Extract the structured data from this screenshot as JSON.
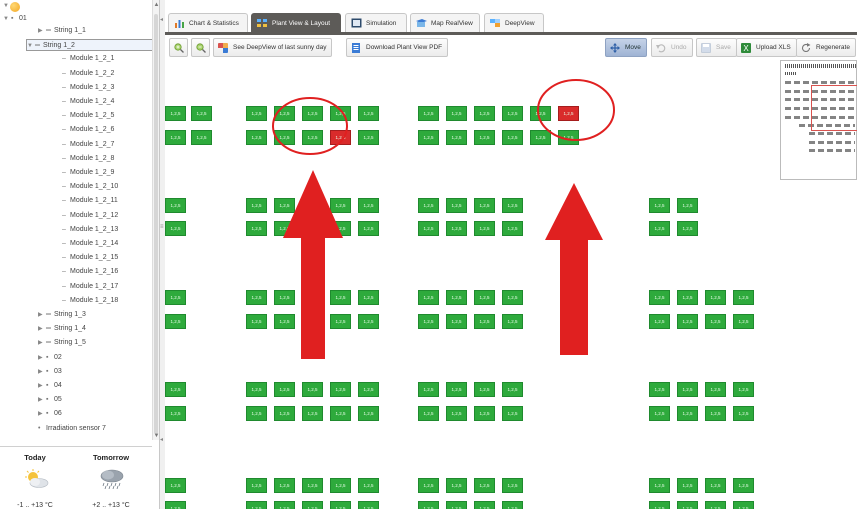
{
  "tree": {
    "root": {
      "label": "01"
    },
    "items": [
      {
        "label": "String 1_1",
        "type": "string",
        "expanded": false
      },
      {
        "label": "String 1_2",
        "type": "string",
        "expanded": true,
        "selected": true
      },
      {
        "label": "Module 1_2_1",
        "type": "module"
      },
      {
        "label": "Module 1_2_2",
        "type": "module"
      },
      {
        "label": "Module 1_2_3",
        "type": "module"
      },
      {
        "label": "Module 1_2_4",
        "type": "module"
      },
      {
        "label": "Module 1_2_5",
        "type": "module"
      },
      {
        "label": "Module 1_2_6",
        "type": "module"
      },
      {
        "label": "Module 1_2_7",
        "type": "module"
      },
      {
        "label": "Module 1_2_8",
        "type": "module"
      },
      {
        "label": "Module 1_2_9",
        "type": "module"
      },
      {
        "label": "Module 1_2_10",
        "type": "module"
      },
      {
        "label": "Module 1_2_11",
        "type": "module"
      },
      {
        "label": "Module 1_2_12",
        "type": "module"
      },
      {
        "label": "Module 1_2_13",
        "type": "module"
      },
      {
        "label": "Module 1_2_14",
        "type": "module"
      },
      {
        "label": "Module 1_2_15",
        "type": "module"
      },
      {
        "label": "Module 1_2_16",
        "type": "module"
      },
      {
        "label": "Module 1_2_17",
        "type": "module"
      },
      {
        "label": "Module 1_2_18",
        "type": "module"
      },
      {
        "label": "String 1_3",
        "type": "string",
        "expanded": false
      },
      {
        "label": "String 1_4",
        "type": "string",
        "expanded": false
      },
      {
        "label": "String 1_5",
        "type": "string",
        "expanded": false
      },
      {
        "label": "02",
        "type": "group"
      },
      {
        "label": "03",
        "type": "group"
      },
      {
        "label": "04",
        "type": "group"
      },
      {
        "label": "05",
        "type": "group"
      },
      {
        "label": "06",
        "type": "group"
      },
      {
        "label": "Irradiation sensor 7",
        "type": "sensor"
      }
    ]
  },
  "weather": {
    "today": {
      "label": "Today",
      "temp": "-1 .. +13 °C",
      "icon": "sun-cloud-icon"
    },
    "tomorrow": {
      "label": "Tomorrow",
      "temp": "+2 .. +13 °C",
      "icon": "cloud-rain-icon"
    }
  },
  "tabs": [
    {
      "label": "Chart & Statistics",
      "icon": "chart-icon",
      "active": false
    },
    {
      "label": "Plant View & Layout",
      "icon": "layout-icon",
      "active": true
    },
    {
      "label": "Simulation",
      "icon": "simulation-icon",
      "active": false
    },
    {
      "label": "Map RealView",
      "icon": "map-icon",
      "active": false
    },
    {
      "label": "DeepView",
      "icon": "deepview-icon",
      "active": false
    }
  ],
  "toolbar": {
    "zoom_in": "zoom-in-icon",
    "zoom_out": "zoom-out-icon",
    "deepview_btn": "See DeepView of last sunny day",
    "download_btn": "Download Plant View PDF",
    "move_btn": "Move",
    "undo_btn": "Undo",
    "save_btn": "Save",
    "upload_btn": "Upload XLS",
    "regenerate_btn": "Regenerate"
  },
  "colors": {
    "module_ok": "#2eaa3c",
    "module_fault": "#d92b2b",
    "annotation": "#e02020",
    "tab_active": "#5d5b58"
  },
  "plant": {
    "module_label": "1,2,5",
    "fault_modules": [
      "row 1 column 6",
      "row 0 column 15"
    ]
  }
}
